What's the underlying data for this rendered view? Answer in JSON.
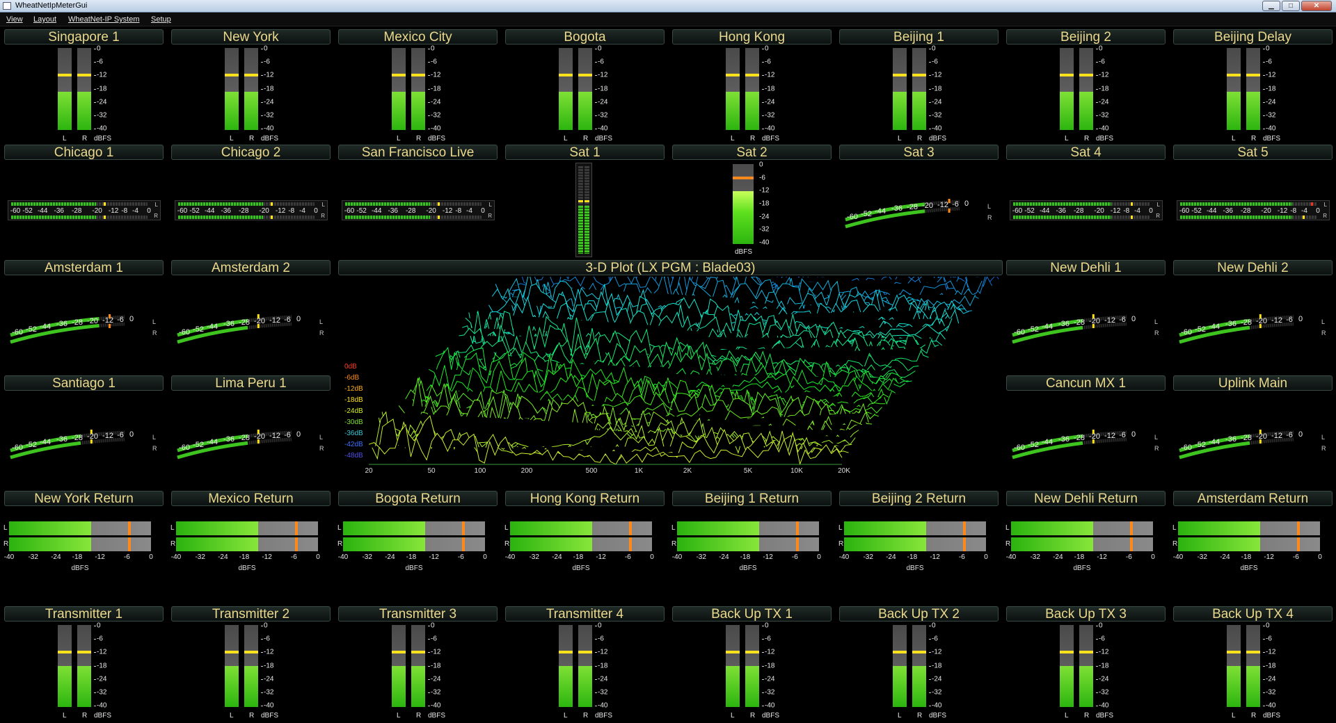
{
  "window": {
    "title": "WheatNetIpMeterGui",
    "buttons": {
      "minimize": "▁",
      "maximize": "□",
      "close": "✕"
    }
  },
  "menu": [
    "View",
    "Layout",
    "WheatNet-IP System",
    "Setup"
  ],
  "colors": {
    "title_text": "#ead88c",
    "meter_green": "#4cc823",
    "peak_yellow": "#ffe21a",
    "peak_orange": "#ff8a1a",
    "background": "#000000"
  },
  "scales": {
    "vertical": [
      "0",
      "-6",
      "-12",
      "-18",
      "-24",
      "-32",
      "-40"
    ],
    "vertical_channels": [
      "L",
      "R"
    ],
    "unit": "dBFS",
    "arc": [
      "-60",
      "-52",
      "-44",
      "-36",
      "-28",
      "-20",
      "-12",
      "-6",
      "0"
    ],
    "arc_channels": [
      "L",
      "R"
    ],
    "flat": [
      "-60",
      "-52",
      "-44",
      "-36",
      "-28",
      "-20",
      "-12",
      "-8",
      "-4",
      "0"
    ],
    "flat_channels": [
      "L",
      "R"
    ],
    "bar": [
      "-40",
      "-32",
      "-24",
      "-18",
      "-12",
      "-6",
      "0"
    ],
    "bar_channels": [
      "L",
      "R"
    ]
  },
  "panels": [
    {
      "title": "Singapore 1",
      "type": "vertical",
      "level_l": 0.47,
      "level_r": 0.47,
      "peak": -12
    },
    {
      "title": "New York",
      "type": "vertical",
      "level_l": 0.47,
      "level_r": 0.47,
      "peak": -12
    },
    {
      "title": "Mexico City",
      "type": "vertical",
      "level_l": 0.47,
      "level_r": 0.47,
      "peak": -12
    },
    {
      "title": "Bogota",
      "type": "vertical",
      "level_l": 0.47,
      "level_r": 0.47,
      "peak": -12
    },
    {
      "title": "Hong Kong",
      "type": "vertical",
      "level_l": 0.47,
      "level_r": 0.47,
      "peak": -12
    },
    {
      "title": "Beijing 1",
      "type": "vertical",
      "level_l": 0.47,
      "level_r": 0.47,
      "peak": -12
    },
    {
      "title": "Beijing 2",
      "type": "vertical",
      "level_l": 0.47,
      "level_r": 0.47,
      "peak": -12
    },
    {
      "title": "Beijing Delay",
      "type": "vertical",
      "level_l": 0.47,
      "level_r": 0.47,
      "peak": -12
    },
    {
      "title": "Chicago 1",
      "type": "flat",
      "level": 0.62,
      "peak_l": 0.68,
      "peak_r": 0.68
    },
    {
      "title": "Chicago 2",
      "type": "flat",
      "level": 0.62,
      "peak_l": 0.68,
      "peak_r": 0.68
    },
    {
      "title": "San Francisco Live",
      "type": "flat",
      "level": 0.62,
      "peak_l": 0.68,
      "peak_r": 0.68
    },
    {
      "title": "Sat 1",
      "type": "mini-vertical",
      "level": 0.55
    },
    {
      "title": "Sat 2",
      "type": "single-vertical",
      "level": 0.66,
      "peak": -6
    },
    {
      "title": "Sat 3",
      "type": "arc",
      "level": 0.7,
      "peak_l": 0.9,
      "peak_r": 0.9
    },
    {
      "title": "Sat 4",
      "type": "flat",
      "level": 0.72,
      "peak_l": 0.86,
      "peak_r": 0.86
    },
    {
      "title": "Sat 5",
      "type": "flat",
      "level": 0.82,
      "peak_l": 0.96,
      "peak_r": 0.9
    },
    {
      "title": "Amsterdam 1",
      "type": "arc",
      "level": 0.78,
      "peak_l": 0.86,
      "peak_r": 0.86
    },
    {
      "title": "Amsterdam 2",
      "type": "arc",
      "level": 0.62,
      "peak_l": 0.7,
      "peak_r": 0.7
    },
    {
      "title": "3-D Plot  (LX PGM : Blade03)",
      "type": "plot"
    },
    {
      "title": "New Dehli 1",
      "type": "arc",
      "level": 0.62,
      "peak_l": 0.7,
      "peak_r": 0.7
    },
    {
      "title": "New Dehli 2",
      "type": "arc",
      "level": 0.62,
      "peak_l": 0.7,
      "peak_r": 0.7
    },
    {
      "title": "Santiago 1",
      "type": "arc",
      "level": 0.62,
      "peak_l": 0.7,
      "peak_r": 0.7
    },
    {
      "title": "Lima Peru 1",
      "type": "arc",
      "level": 0.62,
      "peak_l": 0.7,
      "peak_r": 0.7
    },
    {
      "title": "Cancun MX 1",
      "type": "arc",
      "level": 0.62,
      "peak_l": 0.7,
      "peak_r": 0.7
    },
    {
      "title": "Uplink Main",
      "type": "arc",
      "level": 0.62,
      "peak_l": 0.7,
      "peak_r": 0.7
    },
    {
      "title": "New York Return",
      "type": "bar",
      "level": 0.58,
      "peak": 0.84
    },
    {
      "title": "Mexico  Return",
      "type": "bar",
      "level": 0.58,
      "peak": 0.84
    },
    {
      "title": "Bogota  Return",
      "type": "bar",
      "level": 0.58,
      "peak": 0.84
    },
    {
      "title": "Hong Kong  Return",
      "type": "bar",
      "level": 0.58,
      "peak": 0.84
    },
    {
      "title": "Beijing 1  Return",
      "type": "bar",
      "level": 0.58,
      "peak": 0.84
    },
    {
      "title": "Beijing 2  Return",
      "type": "bar",
      "level": 0.58,
      "peak": 0.84
    },
    {
      "title": "New Dehli  Return",
      "type": "bar",
      "level": 0.58,
      "peak": 0.84
    },
    {
      "title": "Amsterdam Return",
      "type": "bar",
      "level": 0.58,
      "peak": 0.84
    },
    {
      "title": "Transmitter 1",
      "type": "vertical",
      "level_l": 0.5,
      "level_r": 0.5,
      "peak": -12
    },
    {
      "title": "Transmitter 2",
      "type": "vertical",
      "level_l": 0.5,
      "level_r": 0.5,
      "peak": -12
    },
    {
      "title": "Transmitter 3",
      "type": "vertical",
      "level_l": 0.5,
      "level_r": 0.5,
      "peak": -12
    },
    {
      "title": "Transmitter 4",
      "type": "vertical",
      "level_l": 0.5,
      "level_r": 0.5,
      "peak": -12
    },
    {
      "title": "Back Up TX 1",
      "type": "vertical",
      "level_l": 0.5,
      "level_r": 0.5,
      "peak": -12
    },
    {
      "title": "Back Up TX 2",
      "type": "vertical",
      "level_l": 0.5,
      "level_r": 0.5,
      "peak": -12
    },
    {
      "title": "Back Up TX 3",
      "type": "vertical",
      "level_l": 0.5,
      "level_r": 0.5,
      "peak": -12
    },
    {
      "title": "Back Up TX 4",
      "type": "vertical",
      "level_l": 0.5,
      "level_r": 0.5,
      "peak": -12
    }
  ],
  "plot": {
    "db_labels": [
      "0dB",
      "-6dB",
      "-12dB",
      "-18dB",
      "-24dB",
      "-30dB",
      "-36dB",
      "-42dB",
      "-48dB"
    ],
    "db_colors": [
      "#ff3b20",
      "#ff8a1a",
      "#ffb01a",
      "#ffe21a",
      "#d6f020",
      "#7be030",
      "#3bc8d8",
      "#3a70ff",
      "#5050e8"
    ],
    "freq_labels": [
      "20",
      "50",
      "100",
      "200",
      "500",
      "1K",
      "2K",
      "5K",
      "10K",
      "20K"
    ]
  }
}
